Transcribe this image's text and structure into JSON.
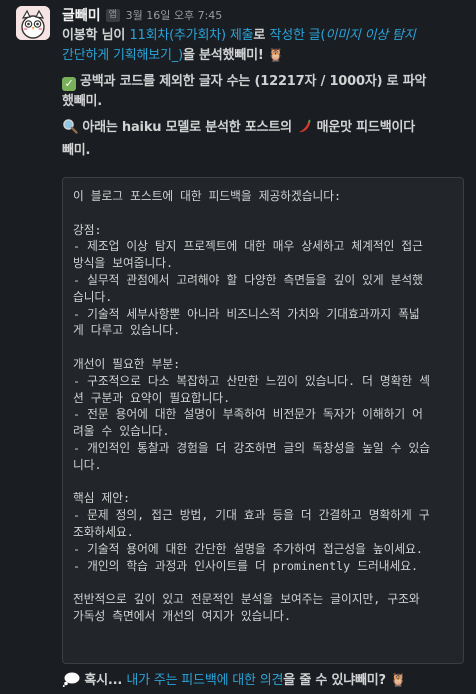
{
  "message": {
    "bot_name": "글빼미",
    "app_badge": "앱",
    "timestamp": "3월 16일 오후 7:45",
    "line1": {
      "user": "이봉학 님이 ",
      "submission_link": "11회차(추가회차) 제출",
      "mid": "로 ",
      "post_link_a": "작성한 글(",
      "post_link_b": "이미지 이상 탐지",
      "post_link_c": "간단하게 기획해보기_",
      "post_link_d": ")",
      "tail": "을 분석했빼미! 🦉"
    },
    "char_count": {
      "emoji": "✓",
      "line_a": "공백과 코드를 제외한 글자 수는 (12217자 / 1000자) 로 파악",
      "line_b": "했빼미."
    },
    "intro": {
      "line_a_pre": "아래는 haiku 모델로 분석한 포스트의 ",
      "line_a_spicy": "매운맛",
      "line_a_post": " 피드백이다",
      "line_b": "빼미."
    },
    "feedback_lines": [
      "이 블로그 포스트에 대한 피드백을 제공하겠습니다:",
      "",
      "강점:",
      "- 제조업 이상 탐지 프로젝트에 대한 매우 상세하고 체계적인 접근",
      "방식을 보여줍니다.",
      "- 실무적 관점에서 고려해야 할 다양한 측면들을 깊이 있게 분석했",
      "습니다.",
      "- 기술적 세부사항뿐 아니라 비즈니스적 가치와 기대효과까지 폭넓",
      "게 다루고 있습니다.",
      "",
      "개선이 필요한 부분:",
      "- 구조적으로 다소 복잡하고 산만한 느낌이 있습니다. 더 명확한 섹",
      "션 구분과 요약이 필요합니다.",
      "- 전문 용어에 대한 설명이 부족하여 비전문가 독자가 이해하기 어",
      "려울 수 있습니다.",
      "- 개인적인 통찰과 경험을 더 강조하면 글의 독창성을 높일 수 있습",
      "니다.",
      "",
      "핵심 제안:",
      "- 문제 정의, 접근 방법, 기대 효과 등을 더 간결하고 명확하게 구",
      "조화하세요.",
      "- 기술적 용어에 대한 간단한 설명을 추가하여 접근성을 높이세요.",
      "- 개인의 학습 과정과 인사이트를 더 prominently 드러내세요.",
      "",
      "전반적으로 깊이 있고 전문적인 분석을 보여주는 글이지만, 구조와",
      "가독성 측면에서 개선의 여지가 있습니다."
    ],
    "question": {
      "pre": "혹시... ",
      "link": "내가 주는 피드백에 대한 의견",
      "post": "을 줄 수 있냐빼미? 🦉"
    }
  },
  "colors": {
    "background": "#1a1d21",
    "text": "#d1d2d3",
    "link": "#2ba3d8",
    "code_bg": "#222529"
  }
}
